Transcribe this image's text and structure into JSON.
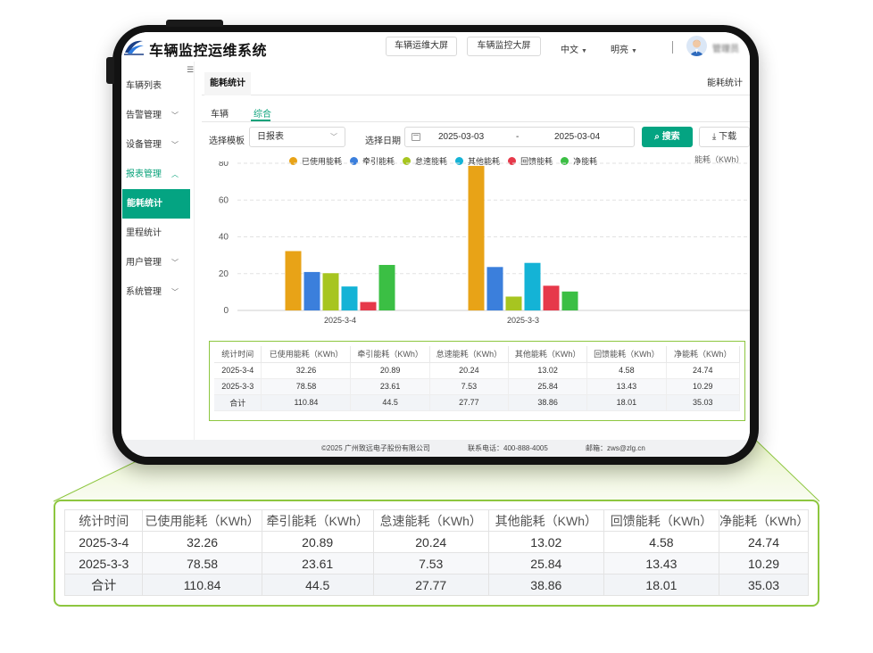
{
  "app": {
    "title": "车辆监控运维系统",
    "ops_screen_button": "车辆运维大屏",
    "monitor_screen_button": "车辆监控大屏",
    "language": "中文",
    "theme": "明亮",
    "user_name": "管理员"
  },
  "sidebar": {
    "items": [
      {
        "label": "车辆列表",
        "state": "normal"
      },
      {
        "label": "告警管理",
        "state": "collapsed"
      },
      {
        "label": "设备管理",
        "state": "collapsed"
      },
      {
        "label": "报表管理",
        "state": "expanded"
      },
      {
        "label": "能耗统计",
        "state": "active"
      },
      {
        "label": "里程统计",
        "state": "normal"
      },
      {
        "label": "用户管理",
        "state": "collapsed"
      },
      {
        "label": "系统管理",
        "state": "collapsed"
      }
    ]
  },
  "page": {
    "title": "能耗统计",
    "breadcrumb": "能耗统计",
    "tabs": [
      {
        "label": "车辆"
      },
      {
        "label": "综合",
        "active": true
      }
    ]
  },
  "filters": {
    "template_label": "选择模板",
    "template_value": "日报表",
    "date_label": "选择日期",
    "date_start": "2025-03-03",
    "date_separator": "-",
    "date_end": "2025-03-04",
    "search_label": "搜索",
    "download_label": "下载"
  },
  "chart_data": {
    "type": "bar",
    "ylabel": "能耗（KWh）",
    "ylim": [
      0,
      80
    ],
    "yticks": [
      0,
      20,
      40,
      60,
      80
    ],
    "grid": true,
    "legend_position": "top-center",
    "categories": [
      "2025-3-4",
      "2025-3-3"
    ],
    "series": [
      {
        "name": "已使用能耗",
        "color": "#e8a317",
        "values": [
          32.26,
          78.58
        ]
      },
      {
        "name": "牵引能耗",
        "color": "#3b7fdc",
        "values": [
          20.89,
          23.61
        ]
      },
      {
        "name": "怠速能耗",
        "color": "#a7c520",
        "values": [
          20.24,
          7.53
        ]
      },
      {
        "name": "其他能耗",
        "color": "#14b3d6",
        "values": [
          13.02,
          25.84
        ]
      },
      {
        "name": "回馈能耗",
        "color": "#e6394a",
        "values": [
          4.58,
          13.43
        ]
      },
      {
        "name": "净能耗",
        "color": "#3bbf44",
        "values": [
          24.74,
          10.29
        ]
      }
    ]
  },
  "table": {
    "headers": [
      "统计时间",
      "已使用能耗（KWh）",
      "牵引能耗（KWh）",
      "怠速能耗（KWh）",
      "其他能耗（KWh）",
      "回馈能耗（KWh）",
      "净能耗（KWh）"
    ],
    "rows": [
      [
        "2025-3-4",
        "32.26",
        "20.89",
        "20.24",
        "13.02",
        "4.58",
        "24.74"
      ],
      [
        "2025-3-3",
        "78.58",
        "23.61",
        "7.53",
        "25.84",
        "13.43",
        "10.29"
      ],
      [
        "合计",
        "110.84",
        "44.5",
        "27.77",
        "38.86",
        "18.01",
        "35.03"
      ]
    ]
  },
  "footer": {
    "copyright": "©2025 广州致远电子股份有限公司",
    "phone": "联系电话：400-888-4005",
    "email": "邮箱：zws@zlg.cn"
  },
  "colors": {
    "accent": "#04a482",
    "highlight_border": "#8dc63f"
  }
}
